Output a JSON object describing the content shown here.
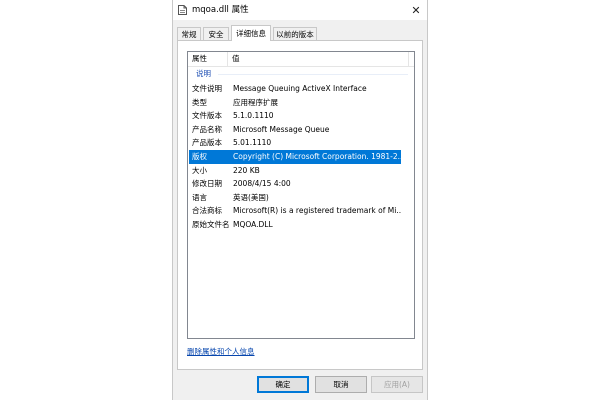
{
  "window": {
    "title": "mqoa.dll 属性",
    "close_glyph": "✕"
  },
  "tabs": [
    {
      "label": "常规"
    },
    {
      "label": "安全"
    },
    {
      "label": "详细信息"
    },
    {
      "label": "以前的版本"
    }
  ],
  "list": {
    "header": {
      "property": "属性",
      "value": "值"
    },
    "group_label": "说明",
    "rows": [
      {
        "key": "文件说明",
        "value": "Message Queuing ActiveX Interface"
      },
      {
        "key": "类型",
        "value": "应用程序扩展"
      },
      {
        "key": "文件版本",
        "value": "5.1.0.1110"
      },
      {
        "key": "产品名称",
        "value": "Microsoft Message Queue"
      },
      {
        "key": "产品版本",
        "value": "5.01.1110"
      },
      {
        "key": "版权",
        "value": "Copyright (C) Microsoft Corporation. 1981-2..."
      },
      {
        "key": "大小",
        "value": "220 KB"
      },
      {
        "key": "修改日期",
        "value": "2008/4/15 4:00"
      },
      {
        "key": "语言",
        "value": "英语(美国)"
      },
      {
        "key": "合法商标",
        "value": "Microsoft(R) is a registered trademark of Mi..."
      },
      {
        "key": "原始文件名",
        "value": "MQOA.DLL"
      }
    ]
  },
  "remove_link": "删除属性和个人信息",
  "buttons": {
    "ok": "确定",
    "cancel": "取消",
    "apply": "应用(A)"
  },
  "colors": {
    "selection": "#0078d7",
    "link": "#0645ad",
    "group": "#1e4fb4"
  }
}
